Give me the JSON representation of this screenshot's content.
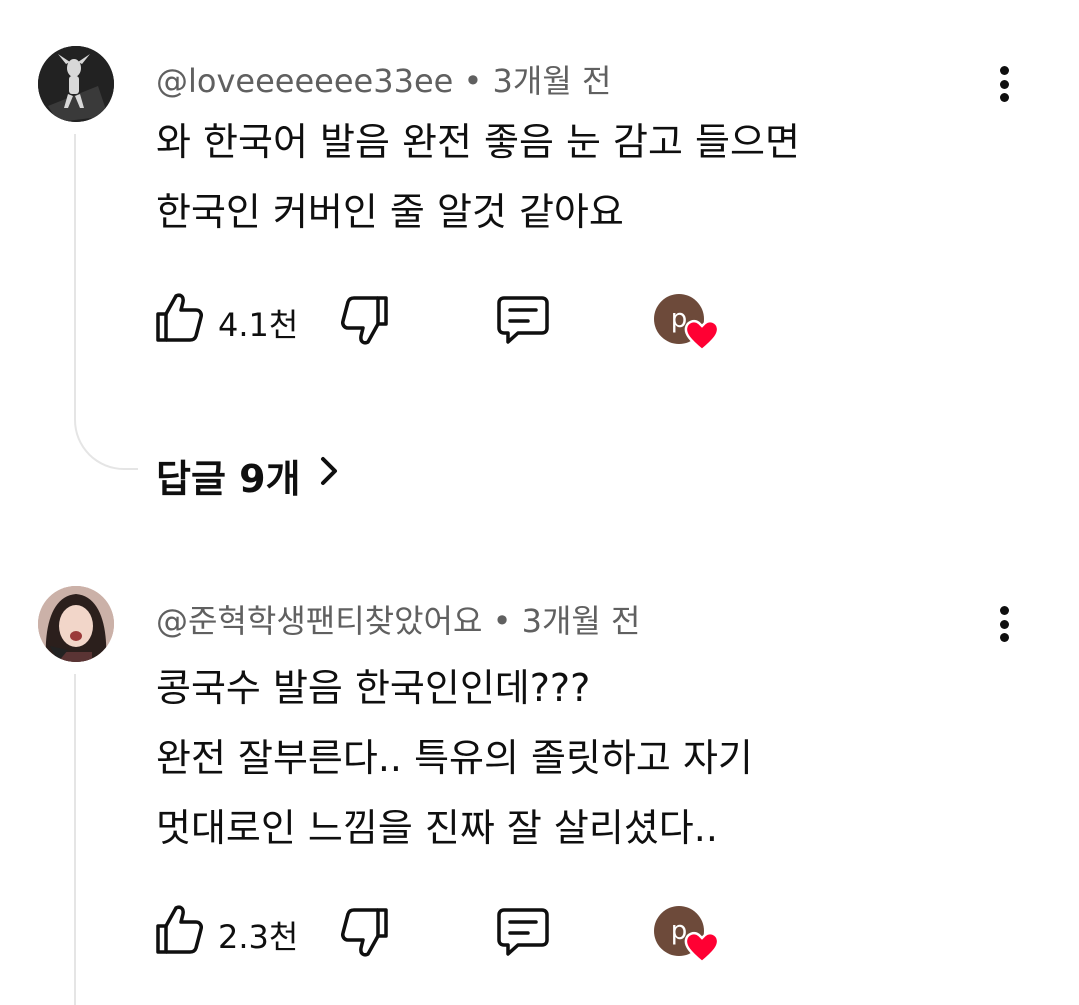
{
  "comments": [
    {
      "username": "@loveeeeeee33ee",
      "separator": "•",
      "time": "3개월 전",
      "lines": [
        "와 한국어 발음 완전 좋음 눈 감고 들으면",
        "한국인 커버인 줄 알것 같아요"
      ],
      "likes": "4.1천",
      "creator_heart_initial": "p",
      "replies_label": "답글 9개"
    },
    {
      "username": "@준혁학생팬티찾았어요",
      "separator": "•",
      "time": "3개월 전",
      "lines": [
        "콩국수 발음 한국인인데???",
        "완전 잘부른다.. 특유의 졸릿하고 자기",
        "멋대로인 느낌을 진짜 잘 살리셨다.."
      ],
      "likes": "2.3천",
      "creator_heart_initial": "p"
    }
  ],
  "icons": {
    "like": "thumbs-up-icon",
    "dislike": "thumbs-down-icon",
    "reply": "comment-icon",
    "more": "more-vert-icon",
    "heart": "heart-icon",
    "chevron": "chevron-right-icon"
  },
  "colors": {
    "heart": "#ff0033",
    "creator_avatar": "#6d4a3a",
    "meta_text": "#606060"
  }
}
